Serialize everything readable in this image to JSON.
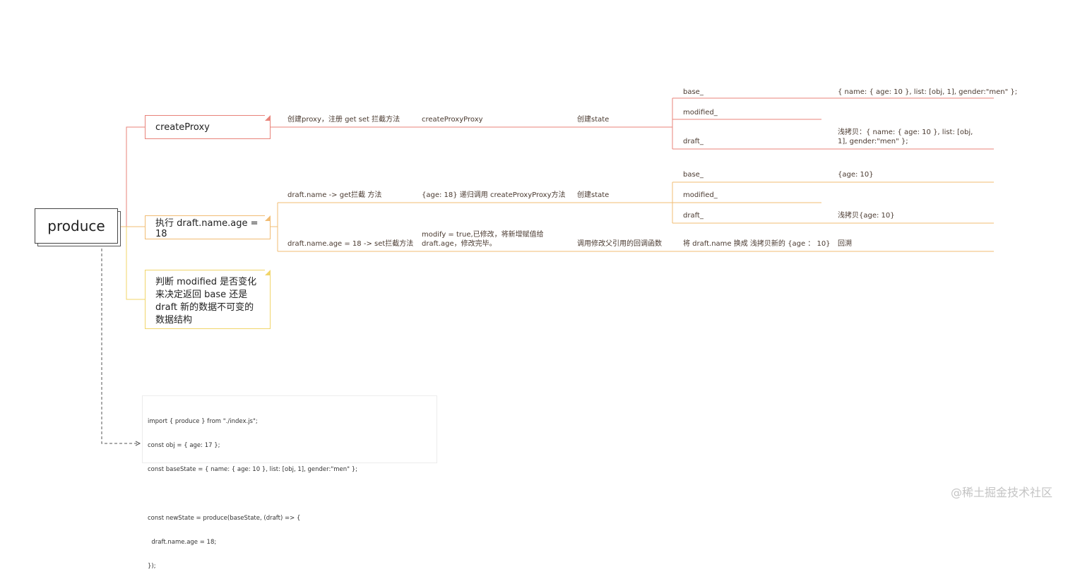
{
  "root": {
    "label": "produce"
  },
  "branches": [
    {
      "id": "create-proxy",
      "label": "createProxy",
      "color": "#e8837a",
      "steps": [
        "创建proxy，注册 get set 拦截方法",
        "createProxyProxy",
        "创建state"
      ],
      "state": [
        {
          "key": "base_",
          "value": "{ name: { age: 10 }, list: [obj, 1], gender:\"men\" };"
        },
        {
          "key": "modified_",
          "value": ""
        },
        {
          "key": "draft_",
          "value": "浅拷贝：{ name: { age: 10 }, list: [obj, 1], gender:\"men\" };"
        }
      ]
    },
    {
      "id": "assign",
      "label": "执行 draft.name.age = 18",
      "color": "#f1bc73",
      "get_steps": [
        "draft.name ->  get拦截 方法",
        "{age: 18} 递归调用 createProxyProxy方法",
        "创建state"
      ],
      "state": [
        {
          "key": "base_",
          "value": "{age: 10}"
        },
        {
          "key": "modified_",
          "value": ""
        },
        {
          "key": "draft_",
          "value": "浅拷贝{age: 10}"
        }
      ],
      "set_steps": [
        "draft.name.age = 18 -> set拦截方法",
        "modify = true,已修改，将新增赋值给draft.age，修改完毕。",
        "调用修改父引用的回调函数",
        "将 draft.name 换成 浅拷贝新的 {age ：  10}",
        "回溯"
      ]
    },
    {
      "id": "decide",
      "label": "判断 modified 是否变化来决定返回 base 还是 draft 新的数据不可变的数据结构",
      "color": "#f1d56a"
    }
  ],
  "code": {
    "lines": [
      "import { produce } from \"./index.js\";",
      "const obj = { age: 17 };",
      "const baseState = { name: { age: 10 }, list: [obj, 1], gender:\"men\" };",
      "",
      "const newState = produce(baseState, (draft) => {",
      "  draft.name.age = 18;",
      "});"
    ]
  },
  "watermark": "@稀土掘金技术社区",
  "colors": {
    "red": "#e8837a",
    "orange": "#f1bc73",
    "yellow": "#f1d56a",
    "connector": "#555555"
  }
}
